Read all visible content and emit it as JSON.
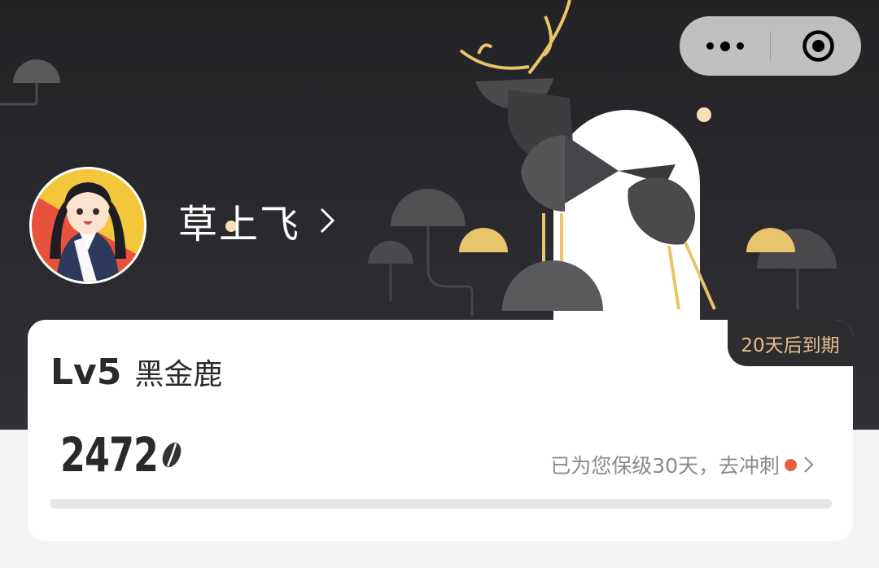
{
  "profile": {
    "username": "草上飞",
    "avatar_icon": "anime-avatar"
  },
  "capsule": {
    "more_icon": "more-dots-icon",
    "close_icon": "target-icon"
  },
  "member": {
    "expire_text": "20天后到期",
    "level_code": "Lv5",
    "level_name": "黑金鹿",
    "points": "2472",
    "points_icon": "coffee-bean-icon",
    "keep_text": "已为您保级30天，去冲刺",
    "progress_fraction": 0
  },
  "colors": {
    "header_bg": "#232326",
    "gold": "#e8c46a",
    "expire_text": "#e6c08a",
    "red_dot": "#e8603c"
  }
}
